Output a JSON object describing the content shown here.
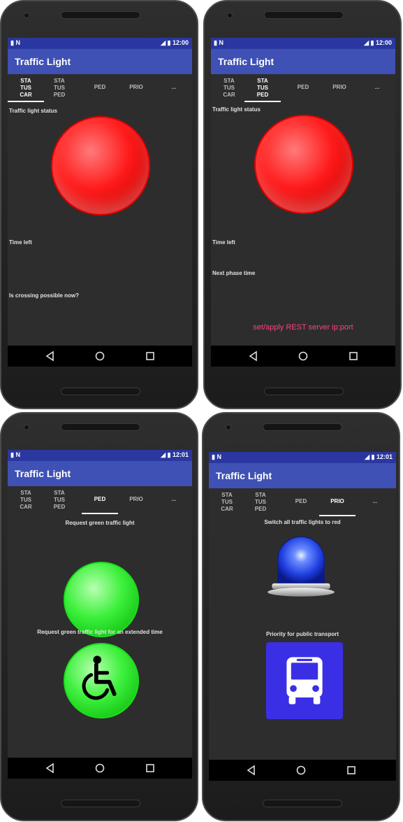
{
  "status_bar": {
    "time": "12:00",
    "time_alt": "12:01",
    "left_icons": "▮ N",
    "right_icons": "◢ ▮"
  },
  "app_title": "Traffic Light",
  "tabs": {
    "status_car": [
      "STA",
      "TUS",
      "CAR"
    ],
    "status_ped": [
      "STA",
      "TUS",
      "PED"
    ],
    "ped": "PED",
    "prio": "PRIO",
    "more": "..."
  },
  "screens": [
    {
      "active_tab": "status_car",
      "time": "12:00",
      "status_label": "Traffic light status",
      "light_color": "#ff1a1a",
      "time_left_label": "Time left",
      "crossing_label": "Is crossing possible now?"
    },
    {
      "active_tab": "status_ped",
      "time": "12:00",
      "status_label": "Traffic light status",
      "light_color": "#ff1a1a",
      "time_left_label": "Time left",
      "next_phase_label": "Next phase time",
      "server_button": "set/apply REST server ip:port"
    },
    {
      "active_tab": "ped",
      "time": "12:01",
      "request_green_label": "Request green traffic light",
      "request_extended_label": "Request green traffic light for an extended time",
      "green_color": "#2ee82e"
    },
    {
      "active_tab": "prio",
      "time": "12:01",
      "switch_red_label": "Switch all traffic lights to red",
      "public_transport_label": "Priority for public transport",
      "bus_button_color": "#3b2fe6",
      "siren_color": "#1f4fff"
    }
  ],
  "icons": {
    "back": "back-triangle-icon",
    "home": "home-circle-icon",
    "recent": "recent-square-icon",
    "wheelchair": "wheelchair-icon",
    "bus": "bus-icon",
    "siren": "siren-icon"
  }
}
